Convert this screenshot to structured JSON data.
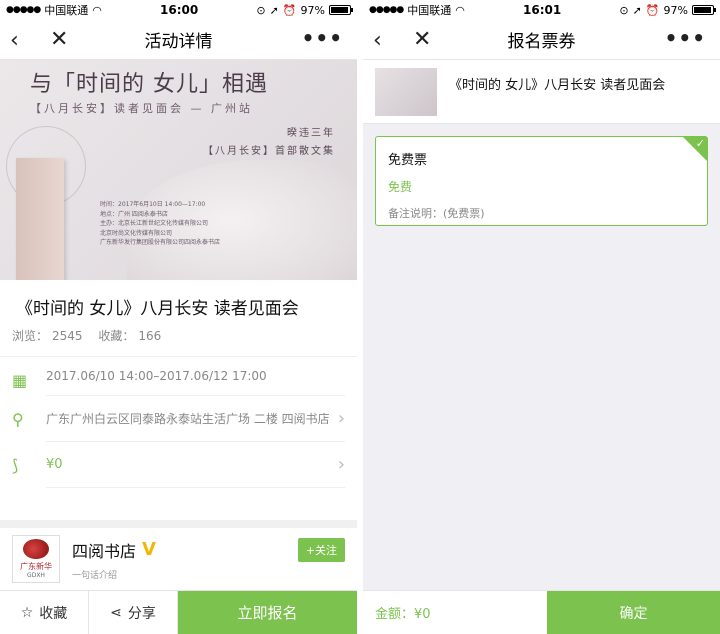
{
  "status_left": {
    "carrier": "中国联通",
    "time": "16:00",
    "battery": "97%"
  },
  "status_right": {
    "carrier": "中国联通",
    "time": "16:01",
    "battery": "97%"
  },
  "left": {
    "nav_title": "活动详情",
    "poster": {
      "title": "与「时间的 女儿」相遇",
      "subtitle": "【八月长安】读者见面会 — 广州站",
      "right_line1": "暌违三年",
      "right_line2": "【八月长安】首部散文集",
      "info_lines": [
        "时间：2017年6月10日 14:00—17:00",
        "地点：广州 四阅永泰书店",
        "主办：北京长江新世纪文化传媒有限公司",
        "北京时尚文化传媒有限公司",
        "广东新华发行集团股份有限公司四阅永泰书店"
      ]
    },
    "event_title": "《时间的 女儿》八月长安 读者见面会",
    "stats": {
      "views_label": "浏览：",
      "views": "2545",
      "favs_label": "收藏：",
      "favs": "166"
    },
    "time_range": "2017.06/10 14:00–2017.06/12 17:00",
    "address": "广东广州白云区同泰路永泰站生活广场 二楼 四阅书店",
    "price": "¥0",
    "shop": {
      "logo_text": "广东新华",
      "logo_sub": "GDXH",
      "name": "四阅书店",
      "badge": "V",
      "intro": "一句话介绍",
      "follow": "+关注"
    },
    "bottom": {
      "fav": "收藏",
      "share": "分享",
      "signup": "立即报名"
    }
  },
  "right": {
    "nav_title": "报名票券",
    "event_title": "《时间的 女儿》八月长安 读者见面会",
    "ticket": {
      "name": "免费票",
      "price": "免费",
      "note": "备注说明：(免费票)"
    },
    "amount": "金额：¥0",
    "confirm": "确定"
  },
  "colors": {
    "accent": "#7cc24e",
    "badge": "#f2b705"
  }
}
